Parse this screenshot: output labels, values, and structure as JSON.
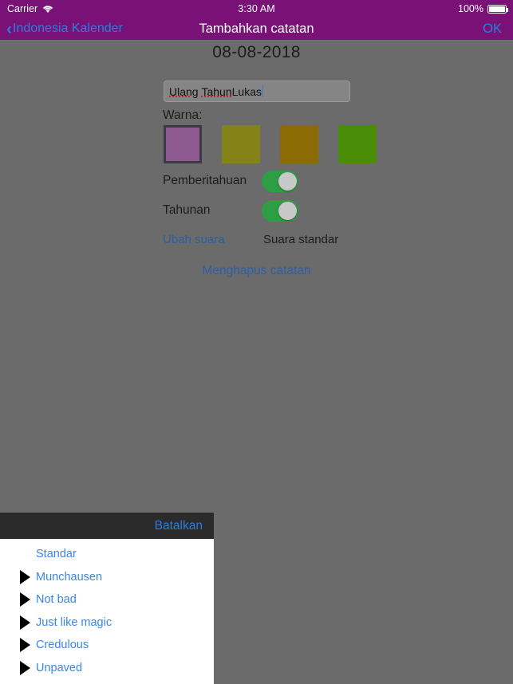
{
  "status_bar": {
    "carrier": "Carrier",
    "wifi_icon": "wifi-icon",
    "time": "3:30 AM",
    "battery_percent": "100%",
    "battery_icon": "battery-full-icon"
  },
  "nav_bar": {
    "back_icon": "chevron-left-icon",
    "back_label": "Indonesia Kalender",
    "title": "Tambahkan catatan",
    "done_label": "OK"
  },
  "main": {
    "date": "08-08-2018",
    "title_field": {
      "value": "Ulang Tahun Lukas",
      "placeholder": "",
      "misspelled_words": [
        "Ulang",
        "Tahun"
      ],
      "rest_text": " Lukas"
    },
    "warna_label": "Warna:",
    "colors": [
      {
        "name": "purple",
        "hex": "#8d5a90",
        "selected": true
      },
      {
        "name": "olive",
        "hex": "#83831a",
        "selected": false
      },
      {
        "name": "dark-gold",
        "hex": "#8c6b04",
        "selected": false
      },
      {
        "name": "green",
        "hex": "#4a8c06",
        "selected": false
      }
    ],
    "settings": [
      {
        "name": "pemberitahuan",
        "label": "Pemberitahuan",
        "enabled": true
      },
      {
        "name": "tahunan",
        "label": "Tahunan",
        "enabled": true
      }
    ],
    "sound": {
      "change_label": "Ubah suara",
      "current_label": "Suara standar"
    },
    "delete_label": "Menghapus catatan"
  },
  "sound_picker": {
    "cancel_label": "Batalkan",
    "items": [
      {
        "label": "Standar",
        "has_play_icon": false
      },
      {
        "label": "Munchausen",
        "has_play_icon": true
      },
      {
        "label": "Not bad",
        "has_play_icon": true
      },
      {
        "label": "Just like magic",
        "has_play_icon": true
      },
      {
        "label": "Credulous",
        "has_play_icon": true
      },
      {
        "label": "Unpaved",
        "has_play_icon": true
      }
    ]
  },
  "colors_meta": {
    "nav_purple": "#7a1177",
    "accent_blue": "#2b7de0",
    "link_blue": "#2b5fa8",
    "list_blue": "#3a86e8",
    "toggle_green": "#2e9e45",
    "dim_background": "#6b6b6b",
    "picker_header": "#2b2b2b"
  }
}
